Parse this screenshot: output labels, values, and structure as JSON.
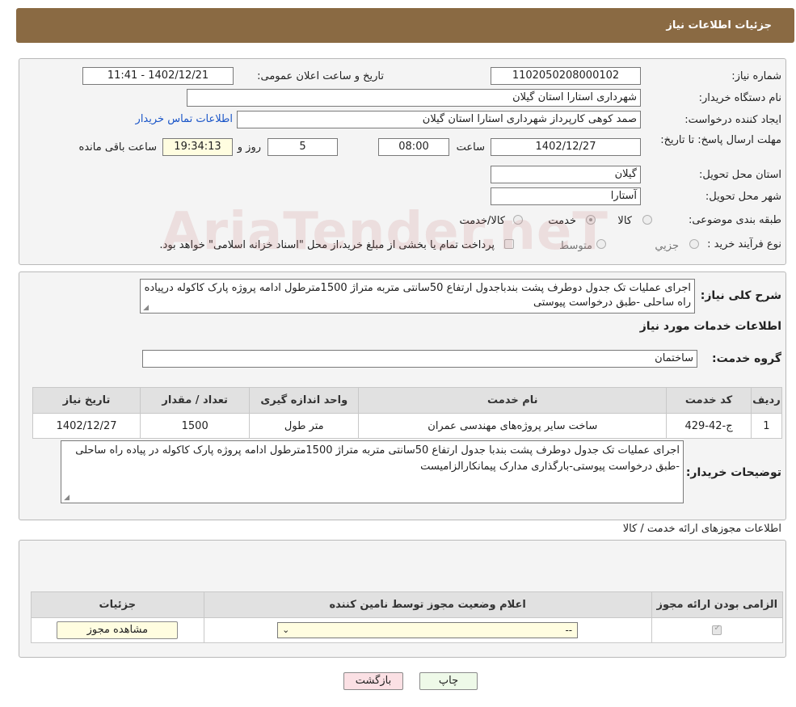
{
  "header": {
    "title": "جزئیات اطلاعات نیاز"
  },
  "form": {
    "need_number_label": "شماره نیاز:",
    "need_number": "1102050208000102",
    "announce_label": "تاریخ و ساعت اعلان عمومی:",
    "announce_value": "1402/12/21 - 11:41",
    "buyer_org_label": "نام دستگاه خریدار:",
    "buyer_org": "شهرداری استارا استان گیلان",
    "creator_label": "ایجاد کننده درخواست:",
    "creator": "صمد کوهی کارپرداز شهرداری استارا استان گیلان",
    "contact_link": "اطلاعات تماس خریدار",
    "deadline_label": "مهلت ارسال پاسخ: تا تاریخ:",
    "deadline_date": "1402/12/27",
    "time_label": "ساعت",
    "deadline_time": "08:00",
    "days_value": "5",
    "days_label": "روز و",
    "remaining_time": "19:34:13",
    "remaining_label": "ساعت باقی مانده",
    "province_label": "استان محل تحویل:",
    "province": "گیلان",
    "city_label": "شهر محل تحویل:",
    "city": "آستارا",
    "category_label": "طبقه بندی موضوعی:",
    "category_options": [
      "کالا",
      "خدمت",
      "کالا/خدمت"
    ],
    "category_selected": "خدمت",
    "process_label": "نوع فرآیند خرید :",
    "process_options": [
      "جزیي",
      "متوسط"
    ],
    "payment_note": "پرداخت تمام یا بخشی از مبلغ خرید،از محل \"اسناد خزانه اسلامی\" خواهد بود."
  },
  "description": {
    "label": "شرح کلی نیاز:",
    "text": "اجرای عملیات تک جدول دوطرف پشت بندباجدول ارتفاع 50سانتی متربه متراژ 1500مترطول ادامه پروژه پارک کاکوله درپیاده راه ساحلی -طبق درخواست پیوستی"
  },
  "services": {
    "section_title": "اطلاعات خدمات مورد نیاز",
    "group_label": "گروه خدمت:",
    "group_value": "ساختمان",
    "columns": [
      "ردیف",
      "کد خدمت",
      "نام خدمت",
      "واحد اندازه گیری",
      "تعداد / مقدار",
      "تاریخ نیاز"
    ],
    "rows": [
      {
        "index": "1",
        "code": "ج-42-429",
        "name": "ساخت سایر پروژه‌های مهندسی عمران",
        "unit": "متر طول",
        "qty": "1500",
        "date": "1402/12/27"
      }
    ]
  },
  "buyer_notes": {
    "label": "توضیحات خریدار:",
    "text": "اجرای عملیات تک جدول دوطرف پشت بندبا جدول ارتفاع 50سانتی متربه متراژ 1500مترطول ادامه پروژه پارک کاکوله در پیاده راه ساحلی -طبق درخواست پیوستی-بارگذاری مدارک پیمانکارالزامیست"
  },
  "permits": {
    "section_title": "اطلاعات مجوزهای ارائه خدمت / کالا",
    "columns": [
      "الزامی بودن ارائه مجوز",
      "اعلام وضعیت مجوز توسط نامین کننده",
      "جزئیات"
    ],
    "row": {
      "required_checked": true,
      "status_value": "--",
      "details_button": "مشاهده مجوز"
    }
  },
  "buttons": {
    "print": "چاپ",
    "back": "بازگشت"
  },
  "watermark": "AriaTender.neT"
}
